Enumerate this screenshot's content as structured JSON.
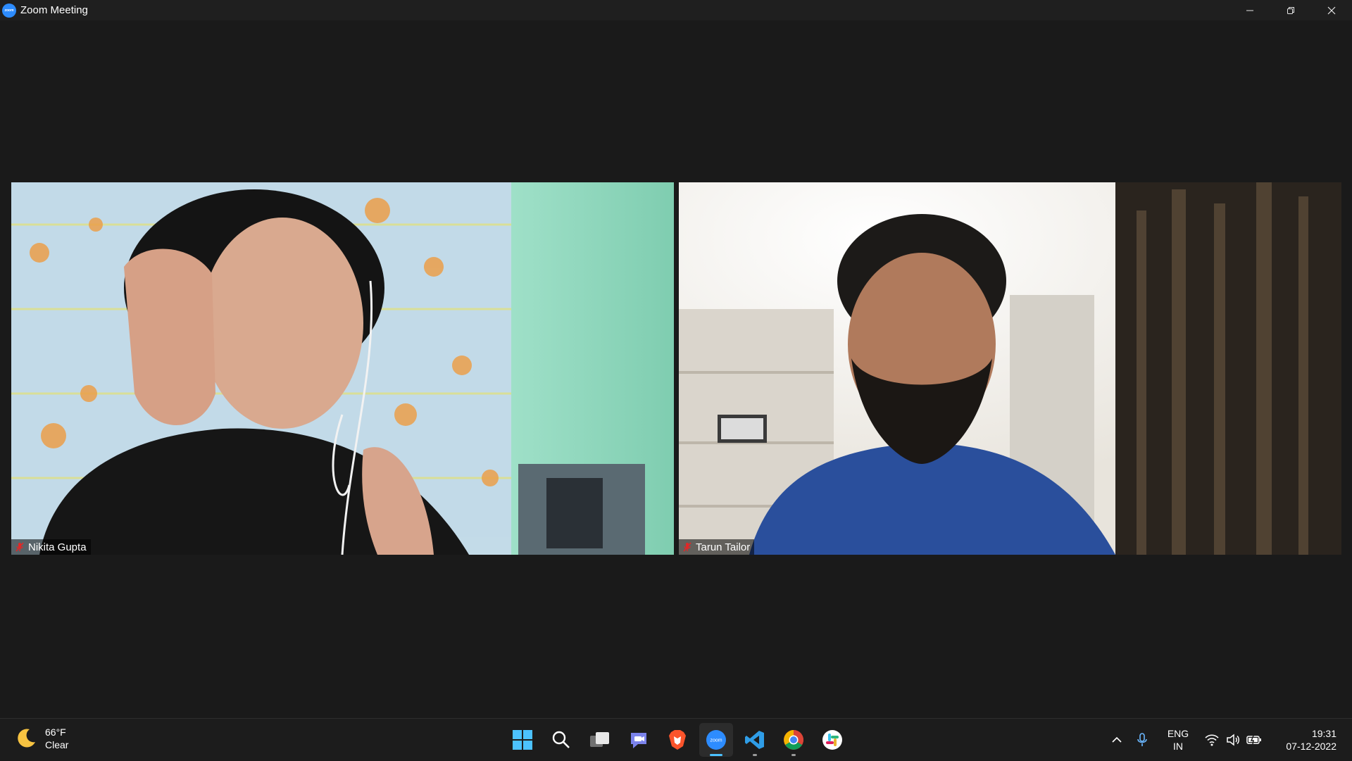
{
  "window": {
    "title": "Zoom Meeting",
    "app_icon": "zoom-icon",
    "controls": [
      "minimize-icon",
      "restore-icon",
      "close-icon"
    ]
  },
  "participants": [
    {
      "name": "Nikita Gupta",
      "muted": true
    },
    {
      "name": "Tarun Tailor",
      "muted": true
    }
  ],
  "taskbar": {
    "weather": {
      "temperature": "66°F",
      "condition": "Clear",
      "icon": "moon-icon"
    },
    "pinned_apps": [
      {
        "name": "Start",
        "icon": "windows-start-icon"
      },
      {
        "name": "Search",
        "icon": "search-icon"
      },
      {
        "name": "Task View",
        "icon": "task-view-icon"
      },
      {
        "name": "Teams Chat",
        "icon": "teams-chat-icon"
      },
      {
        "name": "Brave",
        "icon": "brave-browser-icon"
      },
      {
        "name": "Zoom",
        "icon": "zoom-app-icon",
        "state": "active"
      },
      {
        "name": "VS Code",
        "icon": "vscode-icon",
        "state": "running"
      },
      {
        "name": "Chrome",
        "icon": "chrome-icon",
        "state": "running"
      },
      {
        "name": "Slack",
        "icon": "slack-icon"
      }
    ],
    "tray": {
      "icons": [
        "chevron-up-icon",
        "microphone-icon",
        "wifi-icon",
        "volume-icon",
        "battery-icon"
      ],
      "language": {
        "line1": "ENG",
        "line2": "IN"
      },
      "time": "19:31",
      "date": "07-12-2022"
    }
  },
  "colors": {
    "background": "#1a1a1a",
    "accent": "#2d8cff",
    "mute": "#e02828",
    "taskbar": "#1c1c1c"
  }
}
